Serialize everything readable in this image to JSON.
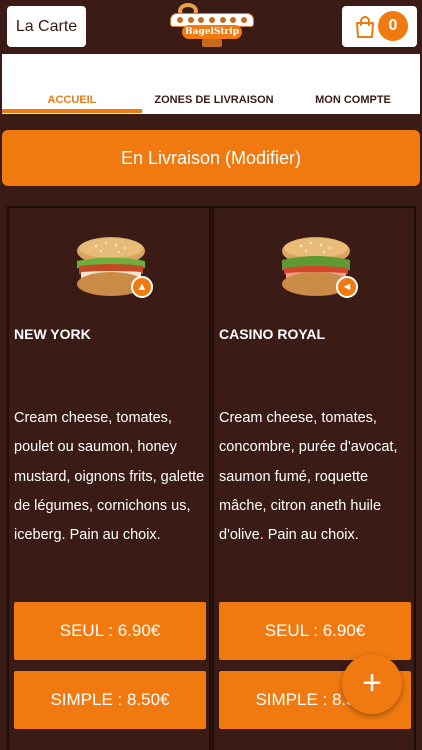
{
  "header": {
    "menu_label": "La Carte",
    "logo_text": "BagelStrip",
    "cart_count": "0"
  },
  "tabs": [
    {
      "label": "ACCUEIL",
      "active": true
    },
    {
      "label": "ZONES DE LIVRAISON",
      "active": false
    },
    {
      "label": "MON COMPTE",
      "active": false
    }
  ],
  "delivery": {
    "label": "En Livraison (Modifier)"
  },
  "products": [
    {
      "name": "NEW YORK",
      "badge_icon": "chicken-icon",
      "description": "Cream cheese, tomates, poulet ou saumon, honey mustard, oignons frits, galette de légumes, cornichons us, iceberg.  Pain au choix.",
      "prices": [
        "SEUL : 6.90€",
        "SIMPLE : 8.50€"
      ]
    },
    {
      "name": "CASINO ROYAL",
      "badge_icon": "fish-icon",
      "description": "Cream cheese, tomates, concombre, purée d'avocat, saumon fumé, roquette mâche, citron aneth huile d'olive.  Pain au choix.",
      "prices": [
        "SEUL : 6.90€",
        "SIMPLE : 8.50€"
      ]
    }
  ],
  "fab": {
    "icon": "plus-icon",
    "label": "+"
  },
  "colors": {
    "brand_orange": "#f07a10",
    "brand_brown": "#3b1b15"
  }
}
